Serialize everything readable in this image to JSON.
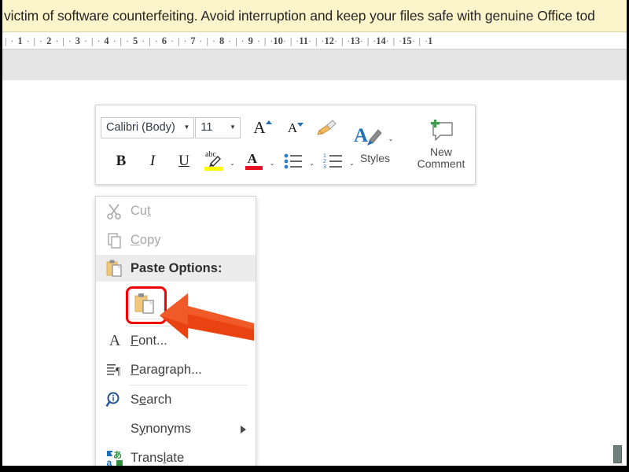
{
  "banner": {
    "text": "victim of software counterfeiting. Avoid interruption and keep your files safe with genuine Office tod"
  },
  "ruler": {
    "marks": [
      "1",
      "2",
      "3",
      "4",
      "5",
      "6",
      "7",
      "8",
      "9",
      "10",
      "11",
      "12",
      "13",
      "14",
      "15",
      "1"
    ]
  },
  "mini_toolbar": {
    "font_name": "Calibri (Body)",
    "font_size": "11",
    "dropdown_arrow": "▾",
    "grow_font": "A",
    "shrink_font": "A",
    "format_painter_icon": "format-painter-icon",
    "bold": "B",
    "italic": "I",
    "underline": "U",
    "highlight_text": "abc",
    "font_color": "A",
    "bullets_icon": "bullet-list-icon",
    "numbering_icon": "numbered-list-icon",
    "chevron": "⌄",
    "styles_label": "Styles",
    "new_comment_label": "New\nComment",
    "new_comment_line1": "New",
    "new_comment_line2": "Comment",
    "colors": {
      "highlight_yellow": "#ffff00",
      "font_color_red": "#e81123",
      "styles_blue": "#1f6fb5",
      "comment_green": "#3f9c4f",
      "painter_orange": "#efb964"
    }
  },
  "context_menu": {
    "items": [
      {
        "label": "Cut",
        "accel": "t",
        "icon": "scissors-icon",
        "disabled": true
      },
      {
        "label": "Copy",
        "accel": "C",
        "icon": "copy-icon",
        "disabled": true
      },
      {
        "label": "Paste Options:",
        "icon": "clipboard-icon",
        "header": true
      },
      {
        "label": "Font...",
        "accel": "F",
        "icon": "font-a-icon",
        "disabled": false
      },
      {
        "label": "Paragraph...",
        "accel": "P",
        "icon": "paragraph-icon",
        "disabled": false
      },
      {
        "label": "Search",
        "accel": "e",
        "icon": "search-magnifier-icon",
        "disabled": false
      },
      {
        "label": "Synonyms",
        "accel": "y",
        "icon": "none",
        "disabled": false,
        "submenu": true
      },
      {
        "label": "Translate",
        "accel": "l",
        "icon": "translate-icon",
        "disabled": false
      }
    ],
    "paste_gallery": {
      "option_name": "keep-source-formatting",
      "highlight_color": "#f50000"
    }
  },
  "annotation": {
    "arrow_color": "#ea4312",
    "arrow_points_to": "paste-keep-source-formatting-button"
  }
}
